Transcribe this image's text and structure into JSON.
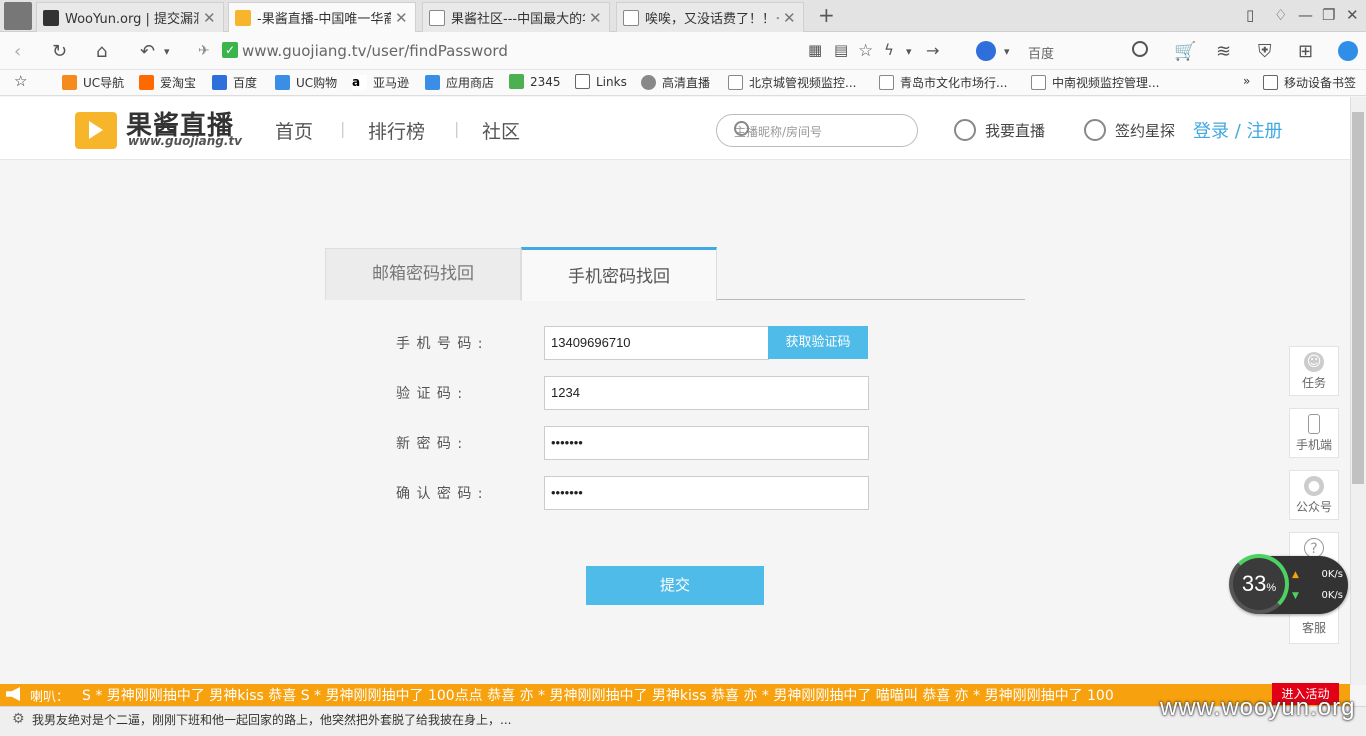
{
  "browser": {
    "tabs": [
      {
        "title": "WooYun.org | 提交漏洞"
      },
      {
        "title": "-果酱直播-中国唯一华裔"
      },
      {
        "title": "果酱社区---中国最大的华"
      },
      {
        "title": "唉唉，又没话费了！！－"
      }
    ],
    "url": "www.guojiang.tv/user/findPassword",
    "search_engine": "百度",
    "bookmarks": [
      "UC导航",
      "爱淘宝",
      "百度",
      "UC购物",
      "亚马逊",
      "应用商店",
      "2345",
      "Links",
      "高清直播",
      "北京城管视频监控...",
      "青岛市文化市场行...",
      "中南视频监控管理..."
    ],
    "more_bookmarks": "»",
    "mobile_bookmarks": "移动设备书签"
  },
  "site": {
    "logo_text": "果酱直播",
    "logo_sub": "www.guojiang.tv",
    "nav": [
      "首页",
      "排行榜",
      "社区"
    ],
    "search_placeholder": "主播昵称/房间号",
    "live_btn": "我要直播",
    "sign_btn": "签约星探",
    "login": "登录",
    "login_sep": " / ",
    "register": "注册"
  },
  "form": {
    "tab_email": "邮箱密码找回",
    "tab_phone": "手机密码找回",
    "phone_label": "手 机 号 码 :",
    "phone_value": "13409696710",
    "get_code": "获取验证码",
    "code_label": "验  证  码 :",
    "code_value": "1234",
    "newpw_label": "新  密  码 :",
    "newpw_value": "•••••••",
    "confirm_label": "确 认 密 码 :",
    "confirm_value": "•••••••",
    "submit": "提交"
  },
  "side": [
    "任务",
    "手机端",
    "公众号",
    "帮助",
    "客服"
  ],
  "speed": {
    "percent": "33",
    "unit": "%",
    "up": "0K/s",
    "down": "0K/s"
  },
  "marquee": {
    "label": "喇叭：",
    "text": "S * 男神刚刚抽中了 男神kiss        恭喜 S * 男神刚刚抽中了 100点点        恭喜 亦 * 男神刚刚抽中了 男神kiss        恭喜 亦 * 男神刚刚抽中了 喵喵叫        恭喜 亦 * 男神刚刚抽中了 100",
    "activity": "进入活动"
  },
  "status_text": "我男友绝对是个二逼，刚刚下班和他一起回家的路上，他突然把外套脱了给我披在身上，...",
  "watermark": "www.wooyun.org"
}
